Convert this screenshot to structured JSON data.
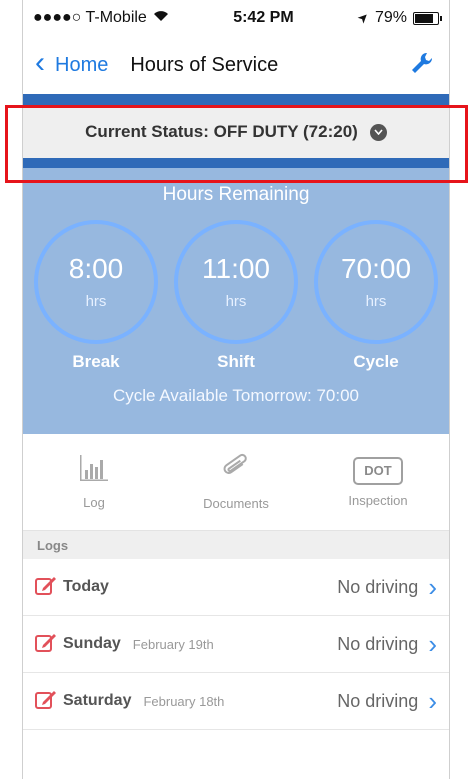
{
  "statusbar": {
    "carrier": "●●●●○ T-Mobile",
    "wifi_icon": "wifi-icon",
    "time": "5:42 PM",
    "location_icon": "➤",
    "battery": "79%"
  },
  "nav": {
    "back_label": "Home",
    "title": "Hours of Service"
  },
  "status": {
    "text": "Current Status: OFF DUTY (72:20)"
  },
  "hours": {
    "title": "Hours Remaining",
    "rings": [
      {
        "value": "8:00",
        "unit": "hrs",
        "label": "Break"
      },
      {
        "value": "11:00",
        "unit": "hrs",
        "label": "Shift"
      },
      {
        "value": "70:00",
        "unit": "hrs",
        "label": "Cycle"
      }
    ],
    "cycle_tomorrow": "Cycle Available Tomorrow: 70:00"
  },
  "tools": {
    "log": "Log",
    "documents": "Documents",
    "dot": "DOT",
    "inspection": "Inspection"
  },
  "logs": {
    "header": "Logs",
    "items": [
      {
        "day": "Today",
        "date": "",
        "status": "No driving"
      },
      {
        "day": "Sunday",
        "date": "February 19th",
        "status": "No driving"
      },
      {
        "day": "Saturday",
        "date": "February 18th",
        "status": "No driving"
      }
    ]
  },
  "colors": {
    "accent": "#1f7ae0",
    "status_bar": "#2f6ab8",
    "hours_bg": "#97b8df",
    "edit_icon": "#e2515a",
    "highlight": "#e6141b"
  }
}
